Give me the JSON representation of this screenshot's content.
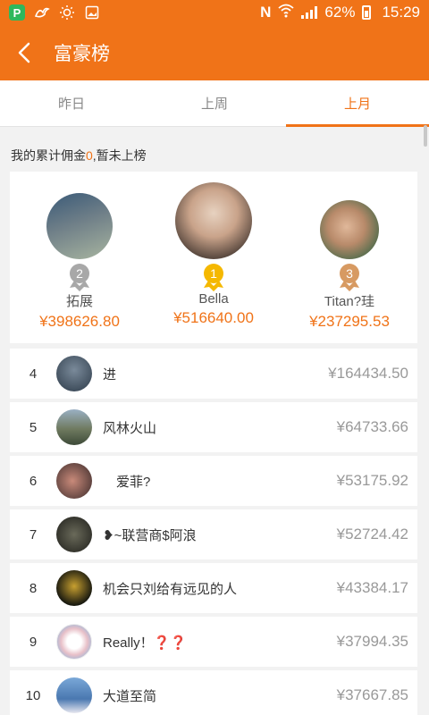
{
  "status_bar": {
    "battery": "62%",
    "time": "15:29",
    "nfc": "N"
  },
  "header": {
    "title": "富豪榜",
    "back_icon": "chevron-left-icon"
  },
  "tabs": [
    {
      "label": "昨日",
      "active": false
    },
    {
      "label": "上周",
      "active": false
    },
    {
      "label": "上月",
      "active": true
    }
  ],
  "my_status": {
    "prefix": "我的累计佣金",
    "amount": "0",
    "suffix": ",暂未上榜"
  },
  "podium": [
    {
      "rank": "2",
      "name": "拓展",
      "amount": "¥398626.80"
    },
    {
      "rank": "1",
      "name": "Bella",
      "amount": "¥516640.00"
    },
    {
      "rank": "3",
      "name": "Titan?珪",
      "amount": "¥237295.53"
    }
  ],
  "list": [
    {
      "rank": "4",
      "name": "进",
      "amount": "¥164434.50"
    },
    {
      "rank": "5",
      "name": "风林火山",
      "amount": "¥64733.66"
    },
    {
      "rank": "6",
      "name": "　爱菲?",
      "amount": "¥53175.92"
    },
    {
      "rank": "7",
      "name": "❥~联营商$阿浪",
      "amount": "¥52724.42"
    },
    {
      "rank": "8",
      "name": "机会只刘给有远见的人",
      "amount": "¥43384.17"
    },
    {
      "rank": "9",
      "name": "Really！❓❓",
      "amount": "¥37994.35"
    },
    {
      "rank": "10",
      "name": "大道至简",
      "amount": "¥37667.85"
    }
  ],
  "colors": {
    "accent": "#f07318",
    "gold": "#f5b800",
    "silver": "#a8a8a8",
    "bronze": "#d79a62"
  }
}
